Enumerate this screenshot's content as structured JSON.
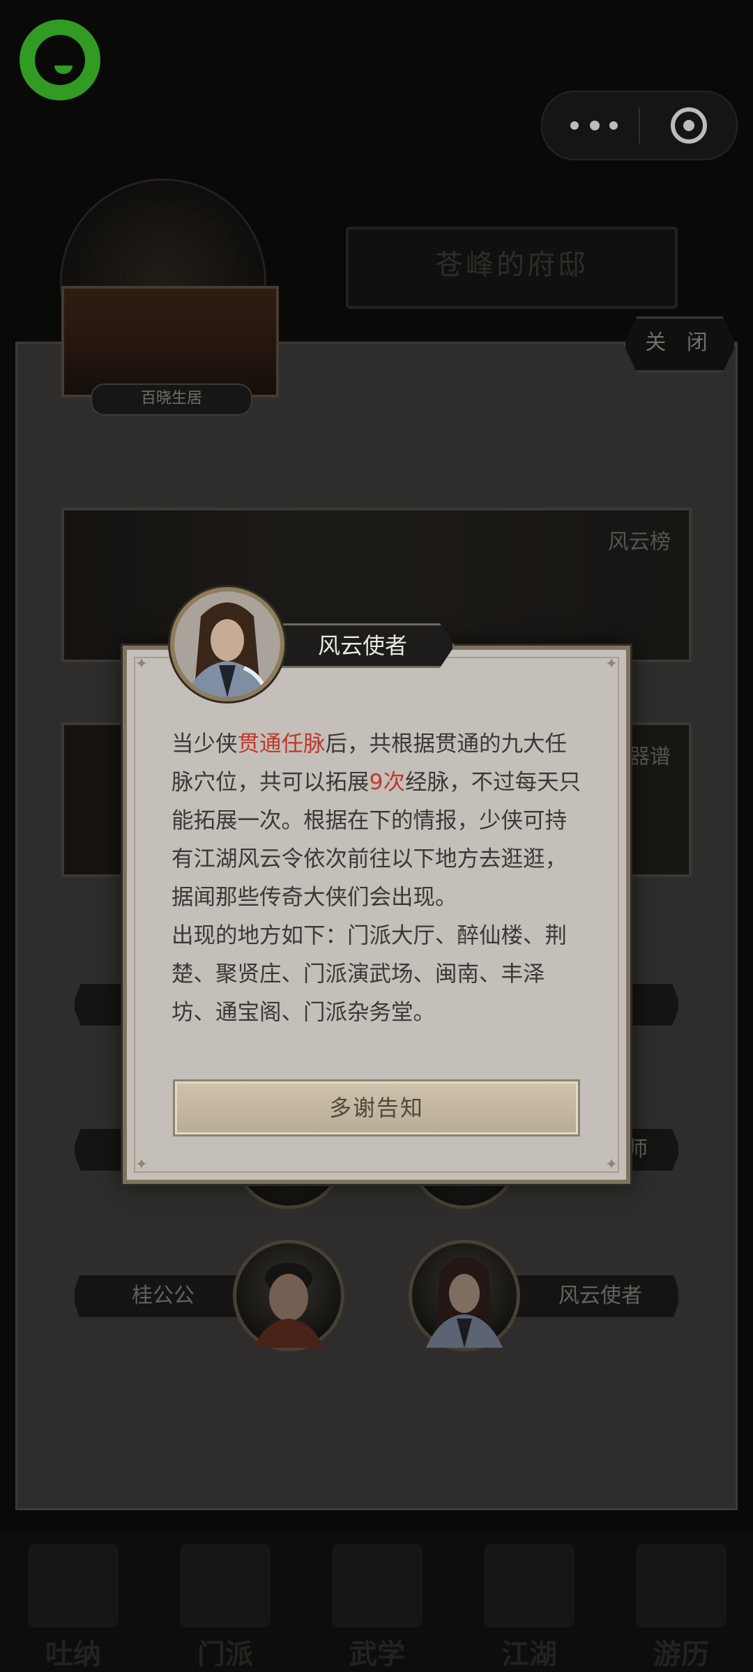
{
  "top_bar": {
    "menu_icon": "more-dots-icon",
    "close_icon": "target-circle-icon"
  },
  "scene": {
    "residence_title": "苍峰的府邸",
    "location_label": "百晓生居",
    "close_label": "关 闭",
    "banners": [
      {
        "label": "风云榜"
      },
      {
        "label": "器谱"
      }
    ],
    "npcs": [
      {
        "name": "桂公公"
      },
      {
        "name": "风云使者"
      }
    ],
    "partial_npc_label": "师"
  },
  "bottom_tabs": [
    {
      "label": "吐纳"
    },
    {
      "label": "门派"
    },
    {
      "label": "武学"
    },
    {
      "label": "江湖"
    },
    {
      "label": "游历"
    }
  ],
  "dialog": {
    "npc_name": "风云使者",
    "text": {
      "p1_a": "当少侠",
      "p1_hl1": "贯通任脉",
      "p1_b": "后，共根据贯通的九大任脉穴位，共可以拓展",
      "p1_hl2": "9次",
      "p1_c": "经脉，不过每天只能拓展一次。根据在下的情报，少侠可持有江湖风云令依次前往以下地方去逛逛，据闻那些传奇大侠们会出现。",
      "p2": "出现的地方如下：门派大厅、醉仙楼、荆楚、聚贤庄、门派演武场、闽南、丰泽坊、通宝阁、门派杂务堂。"
    },
    "confirm_label": "多谢告知",
    "highlight_color": "#c0392b"
  },
  "colors": {
    "wechat_green": "#3dbd2b",
    "dialog_bg": "#c4bfb9",
    "dialog_border": "#7d725f"
  }
}
